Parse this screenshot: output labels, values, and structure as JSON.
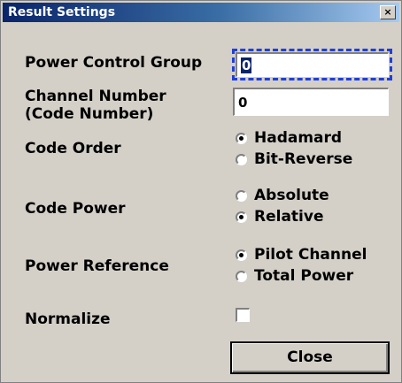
{
  "window": {
    "title": "Result Settings",
    "close_glyph": "×"
  },
  "power_control_group": {
    "label": "Power Control Group",
    "value": "0"
  },
  "channel_number": {
    "label_line1": "Channel Number",
    "label_line2": "(Code Number)",
    "value": "0"
  },
  "code_order": {
    "label": "Code Order",
    "options": [
      {
        "label": "Hadamard",
        "selected": true
      },
      {
        "label": "Bit-Reverse",
        "selected": false
      }
    ]
  },
  "code_power": {
    "label": "Code Power",
    "options": [
      {
        "label": "Absolute",
        "selected": false
      },
      {
        "label": "Relative",
        "selected": true
      }
    ]
  },
  "power_reference": {
    "label": "Power Reference",
    "options": [
      {
        "label": "Pilot Channel",
        "selected": true
      },
      {
        "label": "Total Power",
        "selected": false
      }
    ]
  },
  "normalize": {
    "label": "Normalize",
    "checked": false
  },
  "close_button": {
    "label": "Close"
  }
}
